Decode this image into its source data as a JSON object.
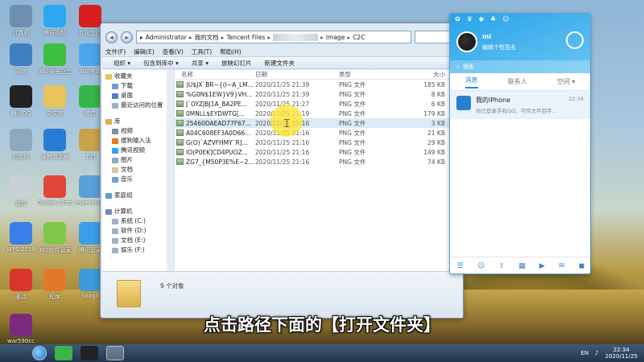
{
  "desktop_icons": [
    {
      "label": "计算机",
      "icon": "computer-icon",
      "color": "#6f8fb0"
    },
    {
      "label": "腾讯视频",
      "icon": "tencent-video-icon",
      "color": "#2da7f0"
    },
    {
      "label": "优化工具",
      "icon": "record-icon",
      "color": "#d81e1e"
    },
    {
      "label": "网络",
      "icon": "network-icon",
      "color": "#3f7fbf"
    },
    {
      "label": "360安全卫士",
      "icon": "360-safe-icon",
      "color": "#3cbf3c"
    },
    {
      "label": "360杀毒",
      "icon": "360-antivirus-icon",
      "color": "#4aa6e8"
    },
    {
      "label": "腾讯QQ",
      "icon": "qq-icon",
      "color": "#222222"
    },
    {
      "label": "文件夹",
      "icon": "folder-icon",
      "color": "#e8c35a"
    },
    {
      "label": "微信",
      "icon": "wechat-icon",
      "color": "#35b54a"
    },
    {
      "label": "回收站",
      "icon": "recycle-bin-icon",
      "color": "#8fa7bf"
    },
    {
      "label": "搜狗浏览器",
      "icon": "sogou-icon",
      "color": "#2a7bd6"
    },
    {
      "label": "工具",
      "icon": "tool-icon",
      "color": "#c9a24a"
    },
    {
      "label": "连接",
      "icon": "connection-icon",
      "color": "#c8d0d8"
    },
    {
      "label": "Google Chrome",
      "icon": "chrome-icon",
      "color": "#e0453a"
    },
    {
      "label": "hypersnap",
      "icon": "hypersnap-icon",
      "color": "#5aa0d8"
    },
    {
      "label": "WPS 2019",
      "icon": "wps-icon",
      "color": "#3a7ee8"
    },
    {
      "label": "360软件管家",
      "icon": "360-manager-icon",
      "color": "#7fc74a"
    },
    {
      "label": "腾讯管家",
      "icon": "tencent-manager-icon",
      "color": "#3a9ee8"
    },
    {
      "label": "驱动",
      "icon": "driver-icon",
      "color": "#d9352b"
    },
    {
      "label": "程序",
      "icon": "program-icon",
      "color": "#e07a2a"
    },
    {
      "label": "Snagit",
      "icon": "snagit-icon",
      "color": "#3a9bd8"
    },
    {
      "label": "war590cc",
      "icon": "winrar-icon",
      "color": "#7a2a7a"
    }
  ],
  "explorer": {
    "path": [
      "Administrator",
      "我的文档",
      "Tencent Files",
      "Image",
      "C2C"
    ],
    "menu": [
      "文件(F)",
      "编辑(E)",
      "查看(V)",
      "工具(T)",
      "帮助(H)"
    ],
    "toolbar": [
      "组织 ▾",
      "包含到库中 ▾",
      "共享 ▾",
      "放映幻灯片",
      "新建文件夹"
    ],
    "nav": [
      {
        "label": "收藏夹",
        "color": "#e8c35a"
      },
      {
        "label": "下载",
        "color": "#6f9ed0"
      },
      {
        "label": "桌面",
        "color": "#4f7fb8"
      },
      {
        "label": "最近访问的位置",
        "color": "#9ab0c8"
      },
      {
        "label": "",
        "color": ""
      },
      {
        "label": "库",
        "color": "#d9b04a"
      },
      {
        "label": "视频",
        "color": "#7f8fa0"
      },
      {
        "label": "搜狗输入法",
        "color": "#e07a2a"
      },
      {
        "label": "腾讯视频",
        "color": "#2da7f0"
      },
      {
        "label": "图片",
        "color": "#8fa7bf"
      },
      {
        "label": "文档",
        "color": "#d8c89a"
      },
      {
        "label": "音乐",
        "color": "#6f9ed0"
      },
      {
        "label": "",
        "color": ""
      },
      {
        "label": "家庭组",
        "color": "#5aa0d8"
      },
      {
        "label": "",
        "color": ""
      },
      {
        "label": "计算机",
        "color": "#6f8fb0"
      },
      {
        "label": "系统 (C:)",
        "color": "#a0b0c0"
      },
      {
        "label": "软件 (D:)",
        "color": "#a0b0c0"
      },
      {
        "label": "文档 (E:)",
        "color": "#a0b0c0"
      },
      {
        "label": "娱乐 (F:)",
        "color": "#a0b0c0"
      }
    ],
    "columns": {
      "name": "名称",
      "date": "日期",
      "type": "类型",
      "size": "大小"
    },
    "files": [
      {
        "name": ")U$JX`BR~{(I~A_LM...",
        "date": "2020/11/25 21:39",
        "type": "PNG 文件",
        "size": "185 KB"
      },
      {
        "name": "%G0N$1EW}V9}VH...",
        "date": "2020/11/25 21:39",
        "type": "PNG 文件",
        "size": "8 KB"
      },
      {
        "name": "J`OYZJBJ1A_BA2PE...",
        "date": "2020/11/25 21:27",
        "type": "PNG 文件",
        "size": "6 KB"
      },
      {
        "name": "0MNLL$EYDWTG[...",
        "date": "2020/11/25 21:19",
        "type": "PNG 文件",
        "size": "179 KB"
      },
      {
        "name": "25460DAEAD77F67...",
        "date": "2020/11/25 21:16",
        "type": "PNG 文件",
        "size": "3 KB"
      },
      {
        "name": "A04C608EF3A0D66...",
        "date": "2020/11/25 21:16",
        "type": "PNG 文件",
        "size": "21 KB"
      },
      {
        "name": "G(O)`AZVFHMY`R]...",
        "date": "2020/11/25 21:16",
        "type": "PNG 文件",
        "size": "29 KB"
      },
      {
        "name": "IO(P0EK]CD4PUOZ...",
        "date": "2020/11/25 21:16",
        "type": "PNG 文件",
        "size": "149 KB"
      },
      {
        "name": "ZG7_{M50P3E%E~2...",
        "date": "2020/11/25 21:16",
        "type": "PNG 文件",
        "size": "74 KB"
      }
    ],
    "item_count": "9 个对象"
  },
  "qq": {
    "nickname": "mi",
    "signature": "编辑个性签名",
    "search_placeholder": "搜索",
    "tabs": [
      "消息",
      "联系人",
      "空间 ▾"
    ],
    "message": {
      "title": "我的iPhone",
      "preview": "你已登录手机QQ，可传文件到手...",
      "time": "22:34"
    }
  },
  "subtitle": "点击路径下面的【打开文件夹】",
  "taskbar": {
    "lang": "EN",
    "time": "22:34",
    "date": "2020/11/25"
  }
}
